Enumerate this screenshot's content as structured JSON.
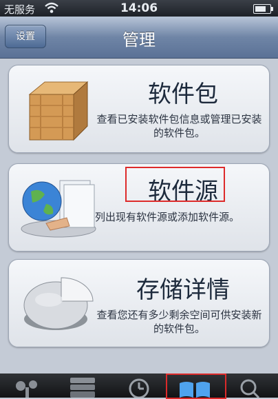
{
  "status": {
    "carrier": "无服务",
    "time": "14:06",
    "battery_level": 0.75
  },
  "nav": {
    "button": "设置",
    "title": "管理"
  },
  "cards": [
    {
      "title": "软件包",
      "desc": "查看已安装软件包信息或管理已安装的软件包。",
      "icon": "package-box-icon"
    },
    {
      "title": "软件源",
      "desc": "列出现有软件源或添加软件源。",
      "icon": "globe-source-icon"
    },
    {
      "title": "存储详情",
      "desc": "查看您还有多少剩余空间可供安装新的软件包。",
      "icon": "pie-storage-icon"
    }
  ],
  "tabs": [
    {
      "name": "cydia-icon"
    },
    {
      "name": "sections-icon"
    },
    {
      "name": "changes-clock-icon"
    },
    {
      "name": "manage-book-icon",
      "selected": true
    },
    {
      "name": "search-icon"
    }
  ],
  "colors": {
    "highlight": "#dd2a2a",
    "nav": "#5a7196"
  }
}
